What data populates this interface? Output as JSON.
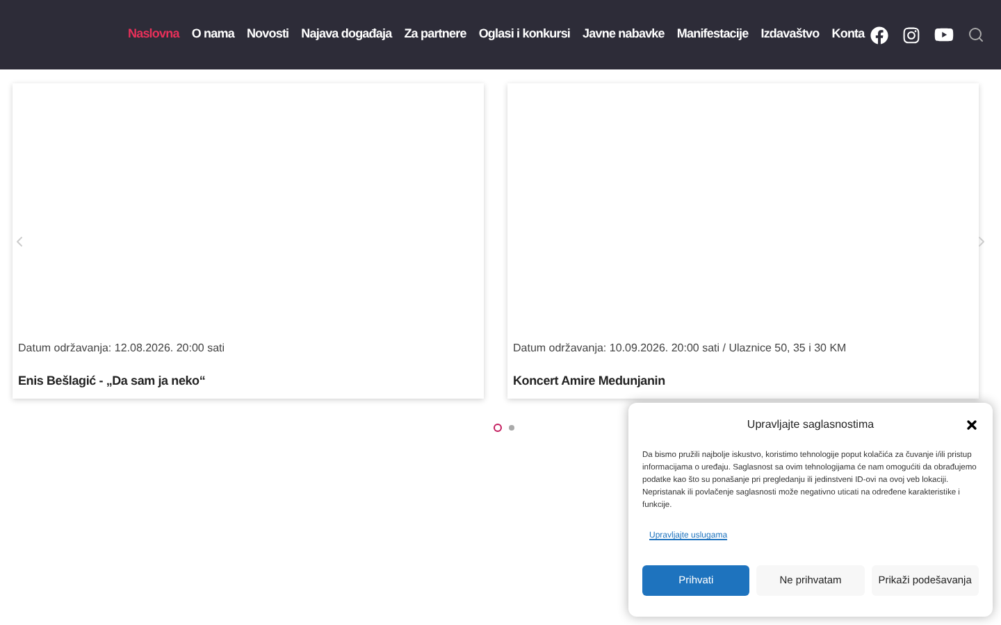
{
  "nav": {
    "items": [
      {
        "label": "Naslovna",
        "selected": true
      },
      {
        "label": "O nama",
        "selected": false
      },
      {
        "label": "Novosti",
        "selected": false
      },
      {
        "label": "Najava događaja",
        "selected": false
      },
      {
        "label": "Za partnere",
        "selected": false
      },
      {
        "label": "Oglasi i konkursi",
        "selected": false
      },
      {
        "label": "Javne nabavke",
        "selected": false
      },
      {
        "label": "Manifestacije",
        "selected": false
      },
      {
        "label": "Izdavaštvo",
        "selected": false
      },
      {
        "label": "Konta",
        "selected": false
      }
    ]
  },
  "events": [
    {
      "date": "Datum održavanja: 12.08.2026. 20:00 sati",
      "title": "Enis Bešlagić - „Da sam ja neko“"
    },
    {
      "date": "Datum održavanja: 10.09.2026. 20:00 sati / Ulaznice 50, 35 i 30 KM",
      "title": "Koncert Amire Medunjanin"
    }
  ],
  "slider_dots": [
    {
      "selected": true
    },
    {
      "selected": false
    }
  ],
  "consent": {
    "title": "Upravljajte saglasnostima",
    "text": "Da bismo pružili najbolje iskustvo, koristimo tehnologije poput kolačića za čuvanje i/ili pristup informacijama o uređaju. Saglasnost sa ovim tehnologijama će nam omogućiti da obrađujemo podatke kao što su ponašanje pri pregledanju ili jedinstveni ID-ovi na ovoj veb lokaciji. Nepristanak ili povlačenje saglasnosti može negativno uticati na određene karakteristike i funkcije.",
    "link": "Upravljajte uslugama",
    "buttons": [
      {
        "label": "Prihvati",
        "kind": "primary"
      },
      {
        "label": "Ne prihvatam",
        "kind": "secondary"
      },
      {
        "label": "Prikaži podešavanja",
        "kind": "secondary"
      }
    ]
  }
}
